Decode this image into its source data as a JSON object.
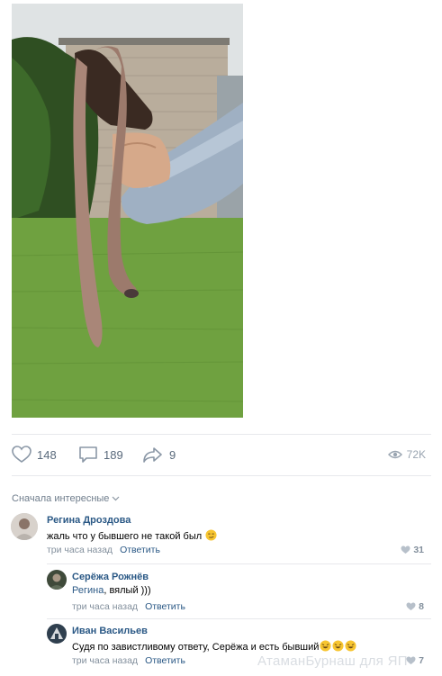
{
  "post": {
    "photo_alt": "worm-photo",
    "likes_count": "148",
    "comments_count": "189",
    "shares_count": "9",
    "views_count": "72K"
  },
  "comments_section": {
    "sort_label": "Сначала интересные",
    "reply_label": "Ответить",
    "comments": [
      {
        "author": "Регина Дроздова",
        "text": "жаль что у бывшего не такой был",
        "time": "три часа назад",
        "likes": "31"
      },
      {
        "author": "Серёжа Рожнёв",
        "mention": "Регина",
        "text": ", вялый )))",
        "time": "три часа назад",
        "likes": "8"
      },
      {
        "author": "Иван Васильев",
        "text": "Судя по завистливому ответу, Серёжа и есть бывший",
        "time": "три часа назад",
        "likes": "7"
      }
    ]
  },
  "watermark": "АтаманБурнаш для ЯП",
  "colors": {
    "link": "#2a5885",
    "meta": "#828f9c",
    "action": "#5a6a7c",
    "divider": "#e7e8ec"
  }
}
